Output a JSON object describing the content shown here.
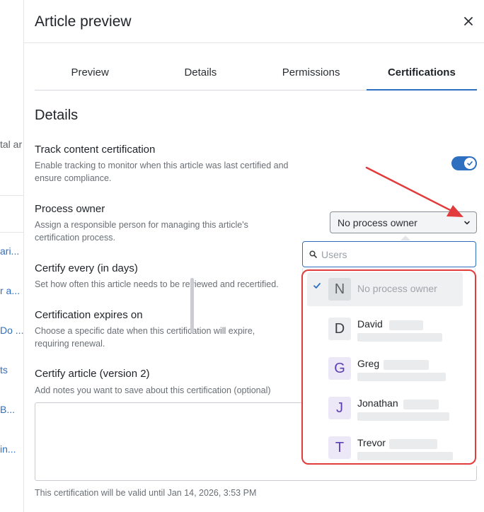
{
  "background": {
    "snippets": [
      "tal ar",
      "ari...",
      "r a...",
      "Do ...",
      "ts",
      "B...",
      "in..."
    ]
  },
  "panel": {
    "title": "Article preview",
    "close_icon": "close-icon"
  },
  "tabs": [
    {
      "label": "Preview",
      "active": false
    },
    {
      "label": "Details",
      "active": false
    },
    {
      "label": "Permissions",
      "active": false
    },
    {
      "label": "Certifications",
      "active": true
    }
  ],
  "section": {
    "title": "Details"
  },
  "fields": {
    "track": {
      "label": "Track content certification",
      "desc": "Enable tracking to monitor when this article was last certified and ensure compliance.",
      "enabled": true
    },
    "owner": {
      "label": "Process owner",
      "desc": "Assign a responsible person for managing this article's certification process.",
      "selected": "No process owner"
    },
    "every": {
      "label": "Certify every (in days)",
      "desc": "Set how often this article needs to be reviewed and recertified."
    },
    "expires": {
      "label": "Certification expires on",
      "desc": "Choose a specific date when this certification will expire, requiring renewal."
    },
    "certify": {
      "label": "Certify article (version 2)",
      "desc": "Add notes you want to save about this certification (optional)"
    }
  },
  "footnote": "This certification will be valid until Jan 14, 2026, 3:53 PM",
  "dropdown": {
    "search_placeholder": "Users",
    "items": [
      {
        "initial": "N",
        "name": "No process owner",
        "selected": true
      },
      {
        "initial": "D",
        "name": "David",
        "selected": false
      },
      {
        "initial": "G",
        "name": "Greg",
        "selected": false
      },
      {
        "initial": "J",
        "name": "Jonathan",
        "selected": false
      },
      {
        "initial": "T",
        "name": "Trevor",
        "selected": false
      }
    ]
  },
  "colors": {
    "accent": "#2f6fc0",
    "annotation": "#e23b3b"
  }
}
